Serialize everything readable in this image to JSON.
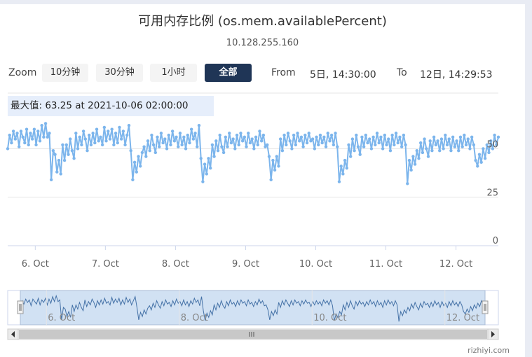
{
  "title": "可用内存比例 (os.mem.availablePercent)",
  "subtitle": "10.128.255.160",
  "range_selector": {
    "zoom_label": "Zoom",
    "buttons": [
      {
        "label": "10分钟",
        "active": false
      },
      {
        "label": "30分钟",
        "active": false
      },
      {
        "label": "1小时",
        "active": false
      },
      {
        "label": "全部",
        "active": true
      }
    ],
    "from_label": "From",
    "from_value": "5日, 14:30:00",
    "to_label": "To",
    "to_value": "12日, 14:29:53"
  },
  "tooltip": "最大值: 63.25 at 2021-10-06 02:00:00",
  "watermark": "rizhiyi.com",
  "colors": {
    "series": "#7cb5ec",
    "navigator_line": "#4572a7",
    "navigator_mask": "#cfdff2",
    "active_button": "#1f3556"
  },
  "chart_data": {
    "type": "line",
    "title": "可用内存比例 (os.mem.availablePercent)",
    "subtitle": "10.128.255.160",
    "x_start": 5.607,
    "x_end": 12.604,
    "ylim": [
      0,
      70
    ],
    "y_ticks": [
      0,
      25,
      50
    ],
    "y_axis_side": "right",
    "x_ticks": [
      {
        "day": 6,
        "label": "6. Oct"
      },
      {
        "day": 7,
        "label": "7. Oct"
      },
      {
        "day": 8,
        "label": "8. Oct"
      },
      {
        "day": 9,
        "label": "9. Oct"
      },
      {
        "day": 10,
        "label": "10. Oct"
      },
      {
        "day": 11,
        "label": "11. Oct"
      },
      {
        "day": 12,
        "label": "12. Oct"
      }
    ],
    "navigator_ticks": [
      {
        "day": 6,
        "label": "6. Oct"
      },
      {
        "day": 8,
        "label": "8. Oct"
      },
      {
        "day": 10,
        "label": "10. Oct"
      },
      {
        "day": 12,
        "label": "12. Oct"
      }
    ],
    "grid": true,
    "series": [
      {
        "values": [
          50,
          57,
          53,
          59,
          55,
          58,
          51,
          59,
          56,
          53,
          60,
          52,
          58,
          55,
          60,
          52,
          59,
          54,
          62,
          56,
          63,
          56,
          58,
          34,
          49,
          47,
          38,
          44,
          37,
          52,
          44,
          52,
          47,
          55,
          49,
          45,
          58,
          50,
          56,
          52,
          59,
          55,
          49,
          57,
          52,
          58,
          53,
          60,
          54,
          56,
          52,
          61,
          54,
          59,
          55,
          60,
          52,
          58,
          53,
          61,
          55,
          59,
          52,
          57,
          62,
          49,
          34,
          43,
          38,
          46,
          41,
          48,
          51,
          46,
          54,
          49,
          57,
          52,
          48,
          56,
          51,
          58,
          53,
          55,
          50,
          57,
          52,
          59,
          54,
          56,
          51,
          58,
          52,
          56,
          50,
          57,
          53,
          60,
          55,
          58,
          51,
          62,
          45,
          33,
          42,
          37,
          45,
          40,
          52,
          46,
          54,
          49,
          57,
          51,
          48,
          56,
          51,
          58,
          53,
          55,
          50,
          57,
          52,
          58,
          54,
          56,
          51,
          58,
          53,
          55,
          50,
          56,
          52,
          59,
          54,
          57,
          51,
          52,
          46,
          34,
          44,
          39,
          46,
          41,
          55,
          49,
          57,
          52,
          58,
          54,
          50,
          57,
          52,
          58,
          54,
          56,
          51,
          57,
          53,
          58,
          54,
          55,
          50,
          56,
          52,
          57,
          53,
          56,
          51,
          58,
          54,
          57,
          52,
          58,
          51,
          33,
          41,
          37,
          44,
          40,
          52,
          46,
          55,
          49,
          57,
          51,
          47,
          56,
          51,
          57,
          53,
          55,
          50,
          56,
          52,
          58,
          53,
          56,
          50,
          57,
          52,
          55,
          49,
          57,
          52,
          58,
          53,
          56,
          51,
          57,
          52,
          32,
          44,
          39,
          46,
          42,
          49,
          45,
          53,
          48,
          55,
          50,
          46,
          54,
          49,
          56,
          52,
          54,
          49,
          55,
          50,
          57,
          52,
          55,
          49,
          56,
          51,
          54,
          49,
          56,
          51,
          57,
          52,
          55,
          50,
          56,
          52,
          44,
          41,
          47,
          43,
          50,
          45,
          52,
          48,
          54,
          50,
          57,
          52,
          56
        ]
      }
    ]
  }
}
